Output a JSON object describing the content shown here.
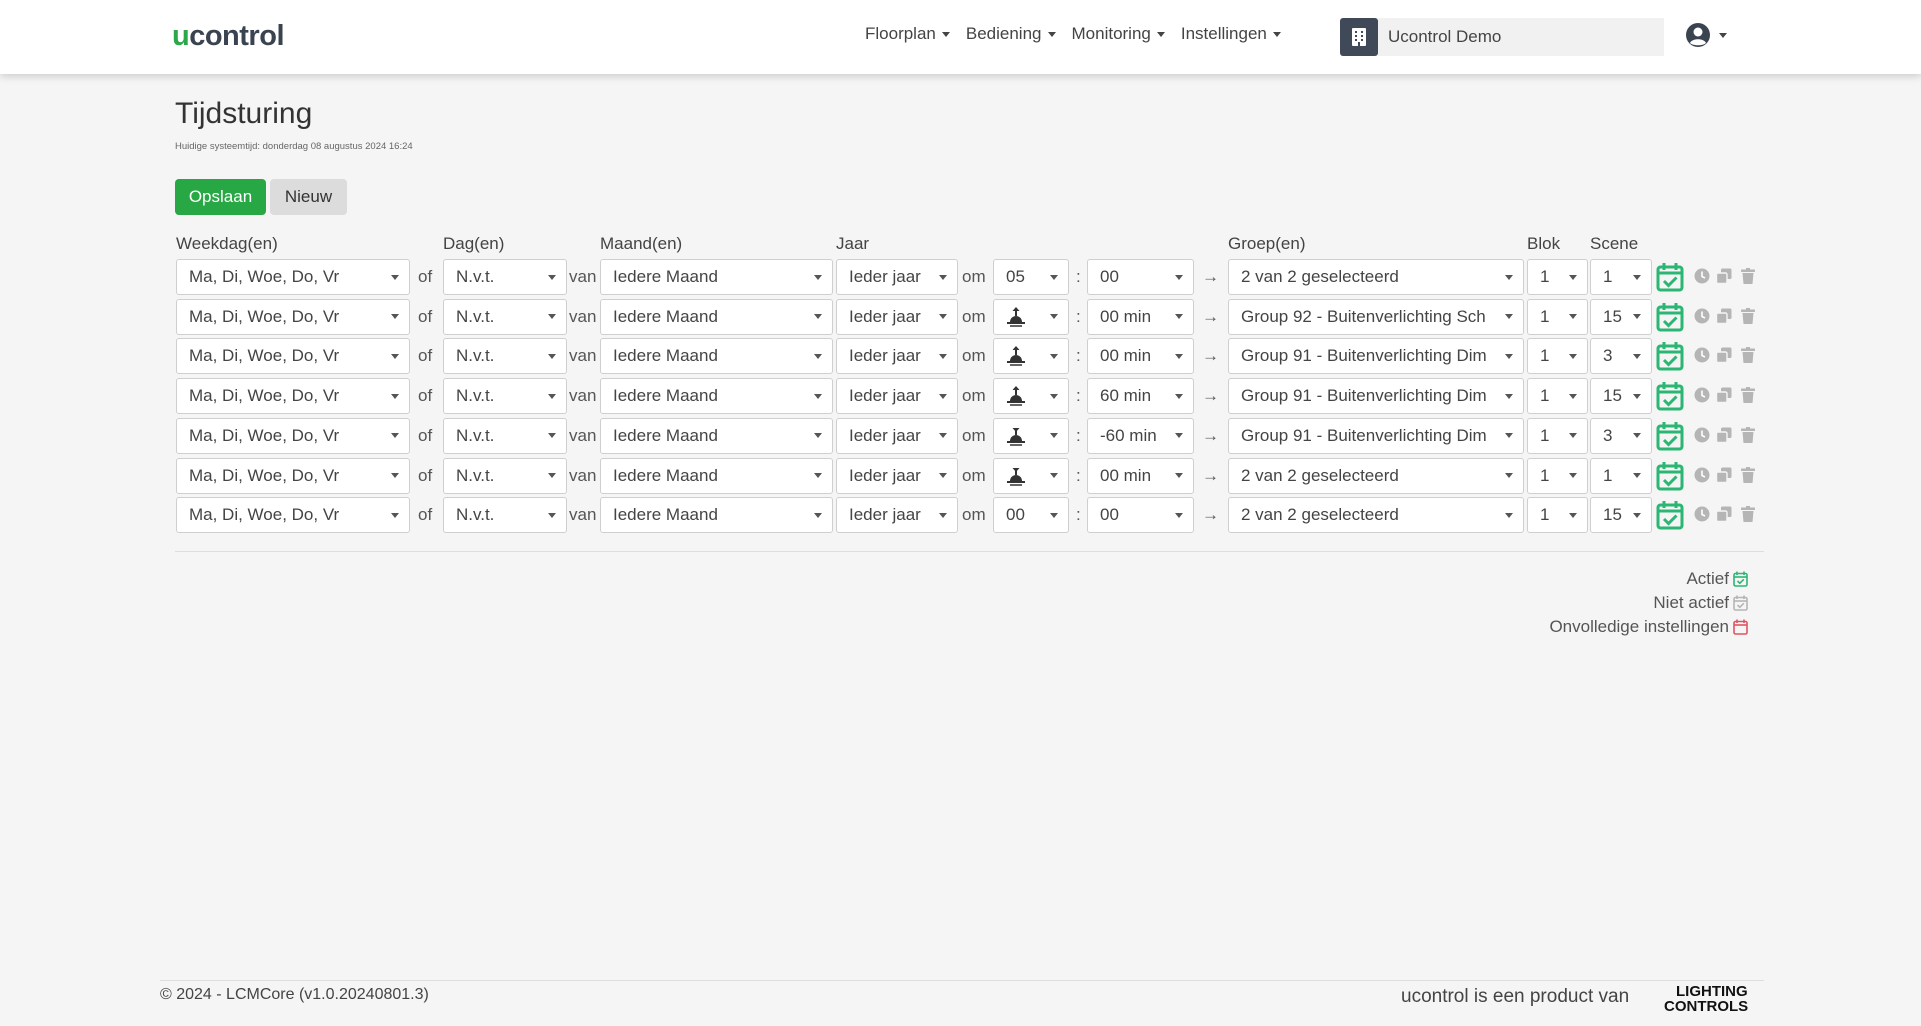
{
  "brand": {
    "logo_u": "u",
    "logo_rest": "contr",
    "logo_bulb": "o",
    "logo_end": "l"
  },
  "nav": {
    "items": [
      "Floorplan",
      "Bediening",
      "Monitoring",
      "Instellingen"
    ],
    "site_name": "Ucontrol Demo"
  },
  "page": {
    "title": "Tijdsturing",
    "systime": "Huidige systeemtijd: donderdag 08 augustus 2024 16:24",
    "save_label": "Opslaan",
    "new_label": "Nieuw"
  },
  "columns": {
    "weekday": "Weekdag(en)",
    "day": "Dag(en)",
    "month": "Maand(en)",
    "year": "Jaar",
    "group": "Groep(en)",
    "block": "Blok",
    "scene": "Scene"
  },
  "connectors": {
    "of": "of",
    "van": "van",
    "om": "om",
    "colon": ":",
    "arrow": "→"
  },
  "rows": [
    {
      "weekday": "Ma, Di, Woe, Do, Vr",
      "day": "N.v.t.",
      "month": "Iedere Maand",
      "year": "Ieder jaar",
      "hour": "05",
      "hour_icon": "",
      "minute": "00",
      "group": "2 van 2 geselecteerd",
      "block": "1",
      "scene": "1",
      "status": "actief"
    },
    {
      "weekday": "Ma, Di, Woe, Do, Vr",
      "day": "N.v.t.",
      "month": "Iedere Maand",
      "year": "Ieder jaar",
      "hour": "",
      "hour_icon": "sunrise-icon",
      "minute": "00 min",
      "group": "Group 92 - Buitenverlichting Sch",
      "block": "1",
      "scene": "15",
      "status": "actief"
    },
    {
      "weekday": "Ma, Di, Woe, Do, Vr",
      "day": "N.v.t.",
      "month": "Iedere Maand",
      "year": "Ieder jaar",
      "hour": "",
      "hour_icon": "sunrise-icon",
      "minute": "00 min",
      "group": "Group 91 - Buitenverlichting Dim",
      "block": "1",
      "scene": "3",
      "status": "actief"
    },
    {
      "weekday": "Ma, Di, Woe, Do, Vr",
      "day": "N.v.t.",
      "month": "Iedere Maand",
      "year": "Ieder jaar",
      "hour": "",
      "hour_icon": "sunrise-icon",
      "minute": "60 min",
      "group": "Group 91 - Buitenverlichting Dim",
      "block": "1",
      "scene": "15",
      "status": "actief"
    },
    {
      "weekday": "Ma, Di, Woe, Do, Vr",
      "day": "N.v.t.",
      "month": "Iedere Maand",
      "year": "Ieder jaar",
      "hour": "",
      "hour_icon": "sunset-icon",
      "minute": "-60 min",
      "group": "Group 91 - Buitenverlichting Dim",
      "block": "1",
      "scene": "3",
      "status": "actief"
    },
    {
      "weekday": "Ma, Di, Woe, Do, Vr",
      "day": "N.v.t.",
      "month": "Iedere Maand",
      "year": "Ieder jaar",
      "hour": "",
      "hour_icon": "sunset-icon",
      "minute": "00 min",
      "group": "2 van 2 geselecteerd",
      "block": "1",
      "scene": "1",
      "status": "actief"
    },
    {
      "weekday": "Ma, Di, Woe, Do, Vr",
      "day": "N.v.t.",
      "month": "Iedere Maand",
      "year": "Ieder jaar",
      "hour": "00",
      "hour_icon": "",
      "minute": "00",
      "group": "2 van 2 geselecteerd",
      "block": "1",
      "scene": "15",
      "status": "actief"
    }
  ],
  "legend": {
    "active": "Actief",
    "inactive": "Niet actief",
    "incomplete": "Onvolledige instellingen"
  },
  "footer": {
    "copyright": "© 2024 - LCMCore (v1.0.20240801.3)",
    "product": "ucontrol is een product van",
    "lc_line1": "LIGHTING",
    "lc_line2": "CONTROLS"
  },
  "colors": {
    "green": "#28a745",
    "active_icon": "#2bb673",
    "inactive_icon": "#b5b5b5",
    "incomplete_icon": "#e05563",
    "navy": "#3f4957"
  }
}
